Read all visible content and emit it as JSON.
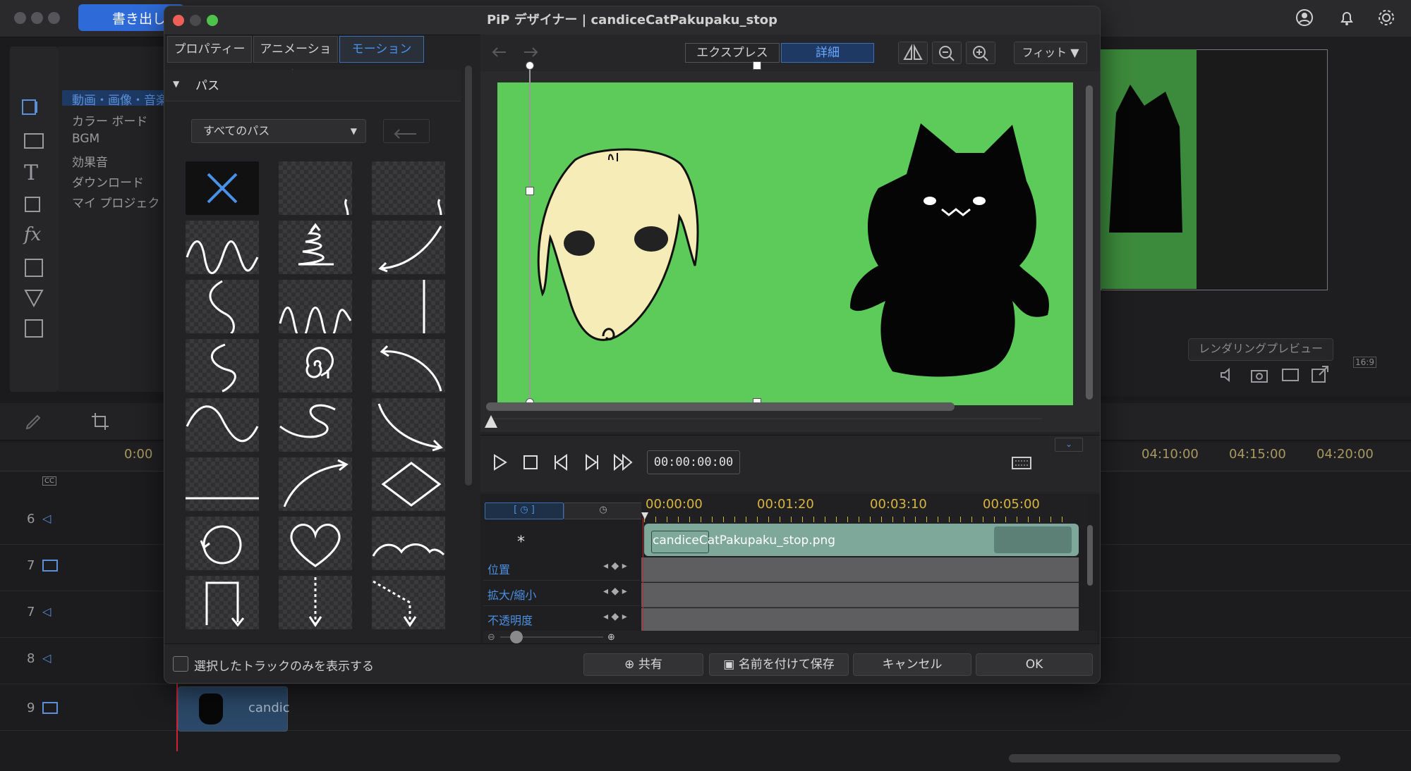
{
  "app": {
    "export_label": "書き出し",
    "library_items": [
      "動画・画像・音楽",
      "カラー ボード",
      "BGM",
      "効果音",
      "ダウンロード",
      "マイ プロジェクト"
    ],
    "render_preview_label": "レンダリングプレビュー",
    "aspect_label": "16:9",
    "ruler_times": [
      "0:00",
      "04:10:00",
      "04:15:00",
      "04:20:00"
    ],
    "tracks": [
      {
        "num": "6",
        "type": "audio"
      },
      {
        "num": "7",
        "type": "video"
      },
      {
        "num": "7",
        "type": "audio"
      },
      {
        "num": "8",
        "type": "audio"
      },
      {
        "num": "9",
        "type": "video"
      }
    ],
    "track9_clip_label": "candic",
    "cc_label": "CC"
  },
  "dialog": {
    "title": "PiP デザイナー | candiceCatPakupaku_stop",
    "tabs": [
      {
        "label": "プロパティー",
        "active": false
      },
      {
        "label": "アニメーション",
        "active": false
      },
      {
        "label": "モーション",
        "active": true
      }
    ],
    "section_title": "パス",
    "path_select_value": "すべてのパス",
    "view_modes": {
      "express": "エクスプレス",
      "detail": "詳細"
    },
    "fit_label": "フィット",
    "timecode": "00:00:00:00",
    "kf_times": [
      "00:00:00",
      "00:01:20",
      "00:03:10",
      "00:05:00"
    ],
    "clip_name": "candiceCatPakupaku_stop.png",
    "kf_rows": [
      "位置",
      "拡大/縮小",
      "不透明度"
    ],
    "asterisk_label": "*",
    "show_selected_label": "選択したトラックのみを表示する",
    "buttons": {
      "share": "共有",
      "save_as": "名前を付けて保存",
      "cancel": "キャンセル",
      "ok": "OK"
    },
    "accent": "#4a90e8",
    "canvas_bg": "#5ccb5a"
  }
}
